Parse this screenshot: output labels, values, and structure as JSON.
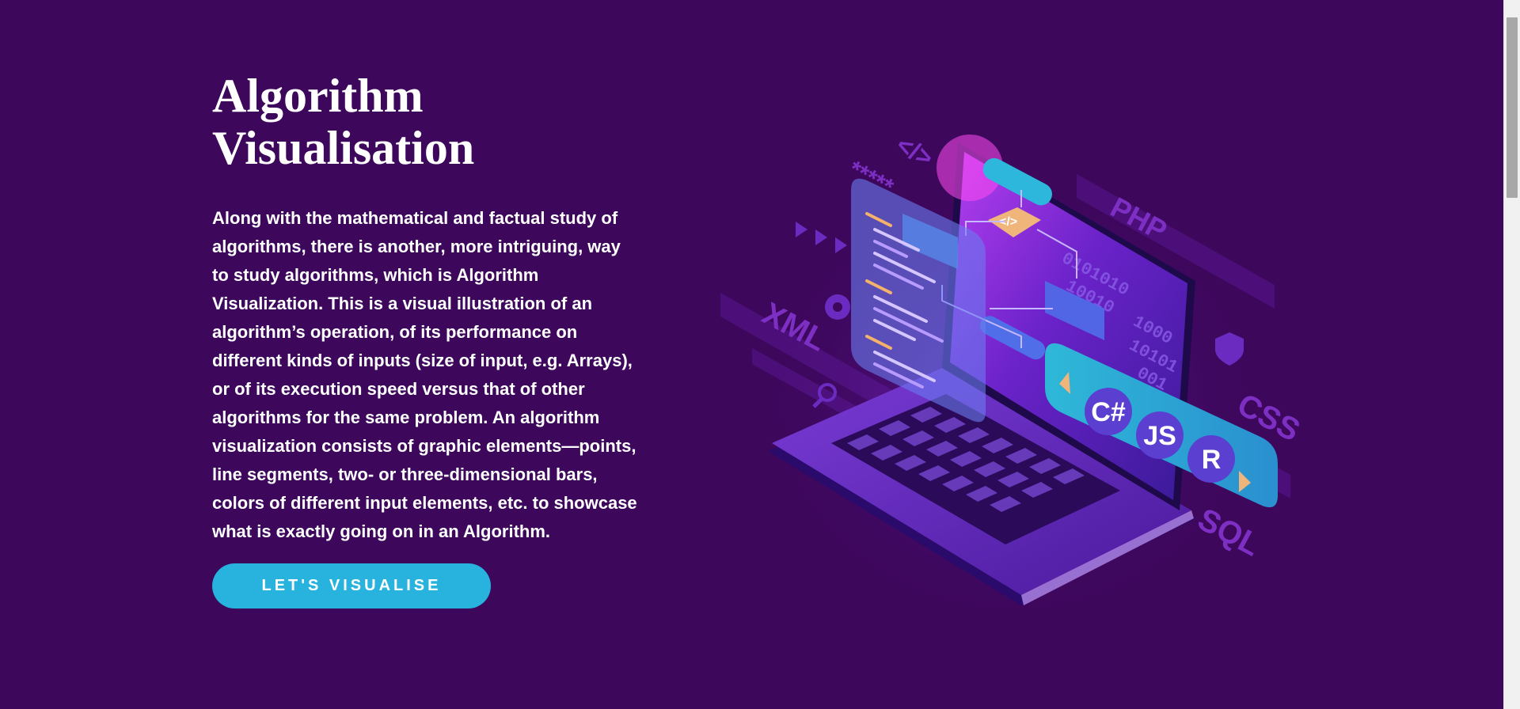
{
  "hero": {
    "title": "Algorithm\nVisualisation",
    "description": "Along with the mathematical and factual study of algorithms, there is another, more intriguing, way to study algorithms, which is Algorithm Visualization. This is a visual illustration of an algorithm’s operation, of its performance on different kinds of inputs (size of input, e.g. Arrays), or of its execution speed versus that of other algorithms for the same problem. An algorithm visualization consists of graphic elements—points, line segments, two- or three-dimensional bars, colors of different input elements, etc. to showcase what is exactly going on in an Algorithm.",
    "cta_label": "LET'S VISUALISE"
  },
  "illustration": {
    "code_tag": "</>",
    "languages": [
      "C#",
      "JS",
      "R"
    ],
    "side_labels": [
      "PHP",
      "XML",
      "CSS",
      "SQL"
    ],
    "asterisks": "*****",
    "binary_lines": [
      "0101010",
      "10010",
      "1000",
      "10101",
      "001"
    ]
  },
  "colors": {
    "background": "#3d075c",
    "accent": "#27b3dd",
    "text": "#ffffff"
  }
}
